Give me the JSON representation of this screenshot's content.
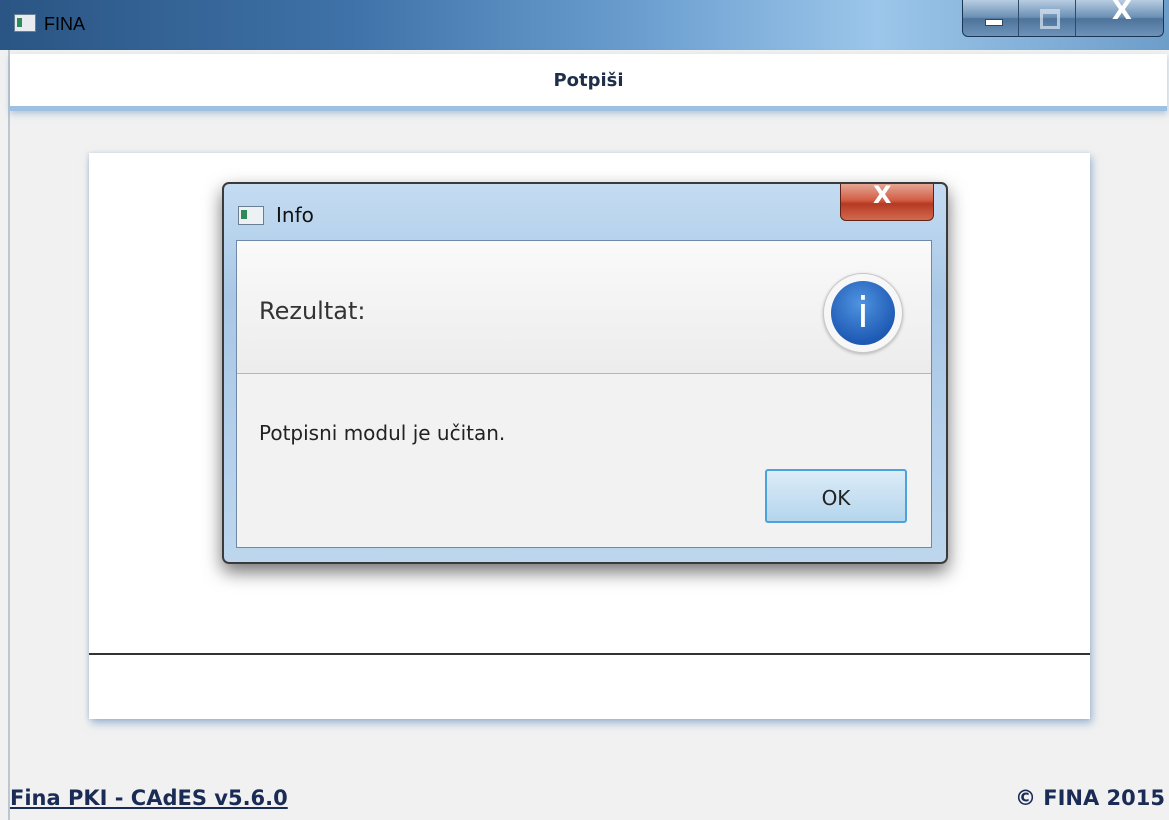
{
  "window": {
    "title": "FINA",
    "app_icon": "app-window-icon",
    "controls": [
      "minimize-icon",
      "maximize-icon",
      "close-icon"
    ],
    "close_glyph": "X"
  },
  "header": {
    "title": "Potpiši"
  },
  "dialog": {
    "title": "Info",
    "close_glyph": "X",
    "heading": "Rezultat:",
    "icon": "info-icon",
    "icon_glyph": "i",
    "message": "Potpisni modul je učitan.",
    "ok_label": "OK"
  },
  "footer": {
    "version_link": "Fina PKI - CAdES v5.6.0",
    "copyright": "© FINA 2015"
  },
  "colors": {
    "header_text": "#1f2f4a",
    "info_blue": "#1f5bb5",
    "ok_border": "#4ca3d9",
    "dialog_close_red": "#d45d45"
  }
}
